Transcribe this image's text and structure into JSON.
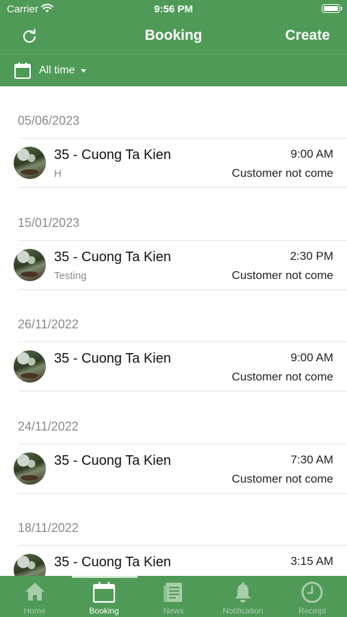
{
  "status_bar": {
    "carrier": "Carrier",
    "time": "9:56 PM"
  },
  "nav": {
    "title": "Booking",
    "create_label": "Create",
    "refresh_icon": "refresh-icon"
  },
  "filter": {
    "label": "All time",
    "icon": "calendar-icon"
  },
  "bookings": [
    {
      "date": "05/06/2023",
      "name": "35 - Cuong Ta Kien",
      "note": "H",
      "time": "9:00 AM",
      "status": "Customer not come"
    },
    {
      "date": "15/01/2023",
      "name": "35 - Cuong Ta Kien",
      "note": "Testing",
      "time": "2:30 PM",
      "status": "Customer not come"
    },
    {
      "date": "26/11/2022",
      "name": "35 - Cuong Ta Kien",
      "note": "",
      "time": "9:00 AM",
      "status": "Customer not come"
    },
    {
      "date": "24/11/2022",
      "name": "35 - Cuong Ta Kien",
      "note": "",
      "time": "7:30 AM",
      "status": "Customer not come"
    },
    {
      "date": "18/11/2022",
      "name": "35 - Cuong Ta Kien",
      "note": "",
      "time": "3:15 AM",
      "status": ""
    }
  ],
  "tabs": [
    {
      "label": "Home",
      "icon": "home-icon",
      "active": false
    },
    {
      "label": "Booking",
      "icon": "calendar-icon",
      "active": true
    },
    {
      "label": "News",
      "icon": "news-icon",
      "active": false
    },
    {
      "label": "Notification",
      "icon": "bell-icon",
      "active": false
    },
    {
      "label": "Receipt",
      "icon": "clock-icon",
      "active": false
    }
  ],
  "colors": {
    "primary": "#4f9a57",
    "tab_inactive": "#a7cdaa",
    "section_header": "#8a8a8a"
  }
}
